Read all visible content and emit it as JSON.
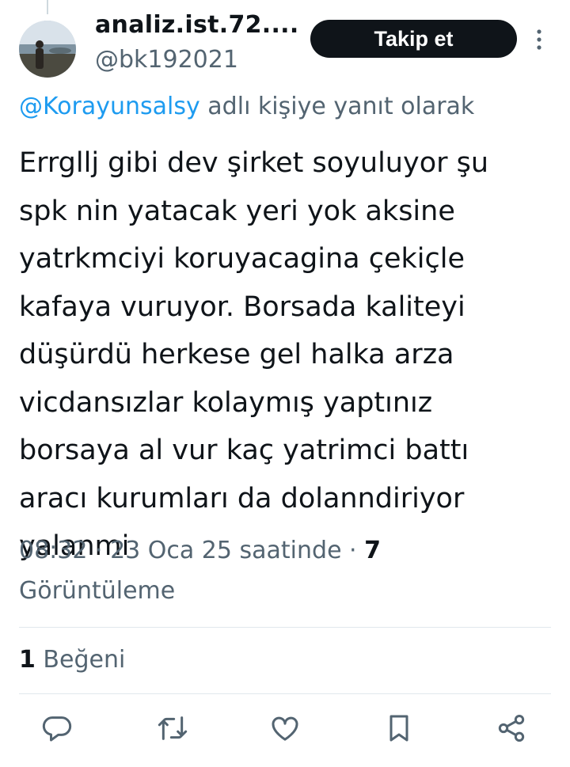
{
  "tweet": {
    "author": {
      "display_name": "analiz.ist.72....",
      "handle": "@bk192021"
    },
    "follow_label": "Takip et",
    "reply_to": {
      "mention": "@Korayunsalsy",
      "suffix": " adlı kişiye yanıt olarak"
    },
    "text": "Errgllj gibi dev şirket soyuluyor şu\nspk nin yatacak yeri yok aksine\nyatrkmciyi koruyacagina çekiçle\nkafaya vuruyor. Borsada kaliteyi\ndüşürdü herkese gel halka arza\nvicdansızlar kolaymış yaptınız\nborsaya al vur kaç yatrimci battı\naracı kurumları da dolanndiriyor\nyalanmi",
    "timestamp": "08:32 · 23 Oca 25 saatinde · ",
    "views_count": "7",
    "views_label": "Görüntüleme",
    "likes_count": "1",
    "likes_label": "Beğeni"
  },
  "icons": {
    "more": "more-vertical-icon",
    "reply": "reply-icon",
    "retweet": "retweet-icon",
    "like": "like-icon",
    "bookmark": "bookmark-icon",
    "share": "share-icon"
  },
  "colors": {
    "text_primary": "#0f1419",
    "text_secondary": "#536471",
    "link": "#1d9bf0",
    "follow_bg": "#0f1419",
    "divider": "#e1e8ed"
  }
}
